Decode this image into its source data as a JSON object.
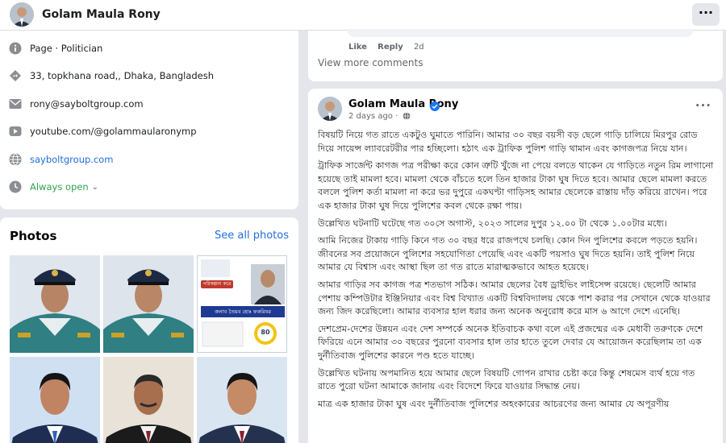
{
  "header": {
    "page_name": "Golam Maula Rony",
    "more_label": "···"
  },
  "intro": {
    "items": [
      {
        "icon": "info-icon",
        "label": "Page · Politician"
      },
      {
        "icon": "location-pin-icon",
        "label": "33, topkhana road,, Dhaka, Bangladesh"
      },
      {
        "icon": "email-icon",
        "label": "rony@sayboltgroup.com"
      },
      {
        "icon": "video-icon",
        "label": "youtube.com/@golammaularonymp"
      },
      {
        "icon": "globe-icon",
        "label": "sayboltgroup.com"
      },
      {
        "icon": "clock-icon",
        "label": "Always open"
      }
    ]
  },
  "photos": {
    "title": "Photos",
    "see_all": "See all photos",
    "poster": {
      "banner": "পরিকল্পনা করে",
      "line": "জনাব তৈয়ব হোঃ ফকরিযর",
      "badge": "80"
    }
  },
  "comment": {
    "like": "Like",
    "reply": "Reply",
    "time": "2d",
    "view_more": "View more comments"
  },
  "post": {
    "author": "Golam Maula Rony",
    "time": "2 days ago ·",
    "more_label": "···",
    "paragraphs": [
      "বিষয়টি নিয়ে গত রাতে একটুও ঘুমাতে পারিনি। আমার ৩০ বছর বয়সী বড় ছেলে গাড়ি চালিয়ে মিরপুর রোড দিয়ে সায়েন্স ল্যাবরেটরীর পার হচ্ছিলো। হঠাৎ এক ট্রাফিক পুলিশ গাড়ি থামান এবং কাগজপত্র নিয়ে যান।",
      "ট্রাফিক সার্জেন্ট কাগজ পত্র পরীক্ষা করে কোন ত্রুটি খুঁজে না পেয়ে বলতে থাকেন যে গাড়িতে নতুন রিম লাগানো হয়েছে তাই মামলা হবে। মামলা থেকে বাঁচতে হলে তিন হাজার টাকা ঘুষ দিতে হবে। আমার ছেলে মামলা করতে বললে পুলিশ কর্তা মামলা না করে ভর দুপুরে একঘণ্টা গাড়িসহ আমার ছেলেকে রাস্তায় দাঁড় করিয়ে রাখেন। পরে এক হাজার টাকা ঘুষ দিয়ে পুলিশের কবল থেকে রক্ষা পায়।",
      "উল্লেখিত ঘটনাটি ঘটেছে গত ৩০সে অগাস্ট, ২০২৩ সালের দুপুর ১২.০০ টা থেকে ১.০০টার মধ্যে।",
      "আমি নিজের টাকায় গাড়ি কিনে গত ৩০ বছর ধরে রাজপথে চলছি। কোন দিন পুলিশের কবলে পড়তে হয়নি। জীবনের সব প্রয়োজনে পুলিশের সহযোগিতা পেয়েছি এবং একটি পয়সাও ঘুষ দিতে হয়নি। তাই পুলিশ নিয়ে আমার যে বিশ্বাস এবং আস্থা ছিল তা গত রাতে মারাত্মকভাবে আহত হয়েছে।",
      "আমার গাড়ির সব কাগজ পত্র শতভাগ সঠিক। আমার ছেলের বৈধ ড্রাইভিং লাইসেন্স রয়েছে। ছেলেটি আমার পেশায় কম্পিউটার ইঞ্জিনিয়ার এবং বিশ্ব বিখ্যাত একটি বিশ্ববিদ্যালয় থেকে পাশ করার পর সেখানে থেকে যাওয়ার জন্য জিদ করেছিলো। আমার ব্যবসার হাল ধরার জন্য অনেক অনুরোধ করে মাস ৬ আগে দেশে এনেছি।",
      "দেশপ্রেম-দেশের উন্নয়ন এবং দেশ সম্পর্কে অনেক ইতিবাচক কথা বলে এই প্রজন্মের এক মেধাবী তরুণকে দেশে ফিরিয়ে এনে আমার ৩০ বছরের পুরনো ব্যবসার হাল তার হাতে তুলে দেবার যে আয়োজন করেছিলাম তা এক দুর্নীতিবাজ পুলিশের কারনে পণ্ড হতে যাচ্ছে।",
      "উল্লেখিত ঘটনায় অপমানিত হয়ে আমার ছেলে বিষয়টি গোপন রাখার চেষ্টা করে কিন্তু শেষমেস ব্যর্থ হয়ে গত রাতে পুরো ঘটনা আমাকে জানায় এবং বিদেশে ফিরে যাওয়ার সিদ্ধান্ত নেয়।",
      "মাত্র এক হাজার টাকা ঘুষ এবং দুর্নীতিবাজ পুলিশের অহংকারের আচরণের জন্য আমার যে অপূরণীয়"
    ]
  }
}
